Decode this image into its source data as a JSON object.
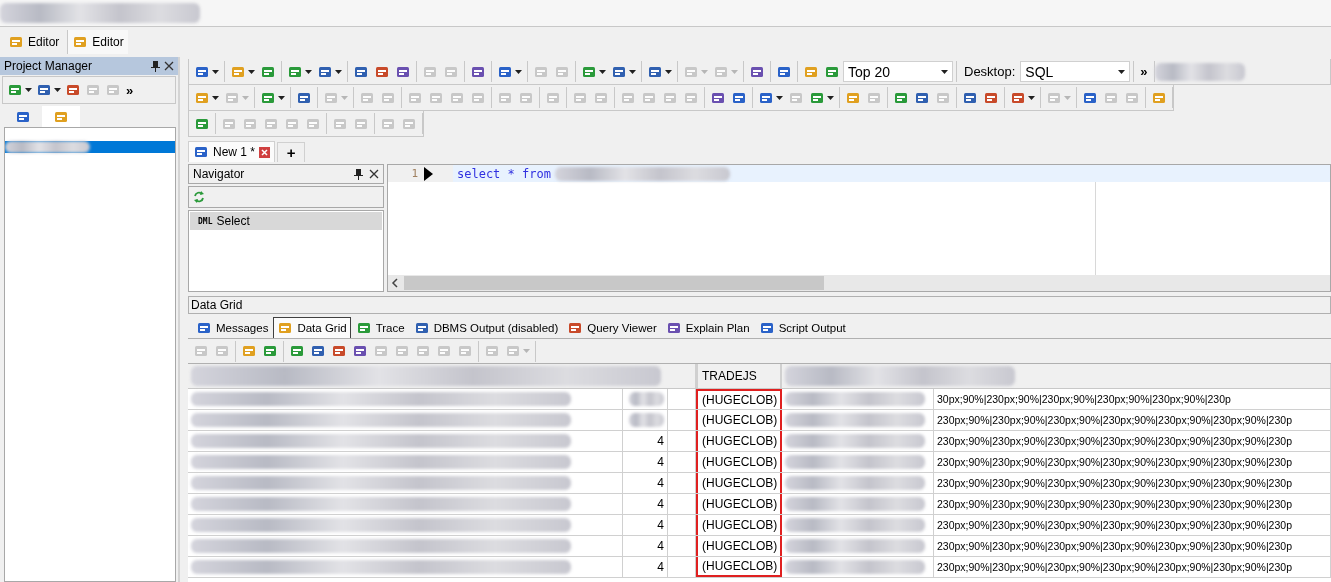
{
  "window_tabs": [
    {
      "label": "Editor",
      "selected": false
    },
    {
      "label": "Editor",
      "selected": true
    }
  ],
  "toolbars": [
    {
      "groups": [
        [
          {
            "kind": "menu_button",
            "disabled": false
          }
        ],
        [
          {
            "kind": "menu_button",
            "disabled": false
          },
          {
            "kind": "button",
            "disabled": false
          }
        ],
        [
          {
            "kind": "menu_button",
            "disabled": false
          },
          {
            "kind": "menu_button",
            "disabled": false
          }
        ],
        [
          {
            "kind": "button",
            "disabled": false
          },
          {
            "kind": "button",
            "disabled": false
          },
          {
            "kind": "button",
            "disabled": false
          }
        ],
        [
          {
            "kind": "button",
            "disabled": true
          },
          {
            "kind": "button",
            "disabled": true
          }
        ],
        [
          {
            "kind": "button",
            "disabled": false
          }
        ],
        [
          {
            "kind": "menu_button",
            "disabled": false
          }
        ],
        [
          {
            "kind": "button",
            "disabled": true
          },
          {
            "kind": "button",
            "disabled": true
          }
        ],
        [
          {
            "kind": "menu_button",
            "disabled": false
          },
          {
            "kind": "menu_button",
            "disabled": false
          }
        ],
        [
          {
            "kind": "menu_button",
            "disabled": false
          }
        ],
        [
          {
            "kind": "menu_button",
            "disabled": true
          },
          {
            "kind": "menu_button",
            "disabled": true
          }
        ],
        [
          {
            "kind": "button",
            "disabled": false
          }
        ],
        [
          {
            "kind": "button",
            "disabled": false
          }
        ],
        [
          {
            "kind": "button",
            "disabled": false
          },
          {
            "kind": "button",
            "disabled": false
          },
          {
            "kind": "combo",
            "value": "Top 20"
          }
        ],
        [
          {
            "kind": "label",
            "text": "Desktop:"
          },
          {
            "kind": "combo",
            "value": "SQL"
          }
        ],
        [
          {
            "kind": "more",
            "text": "»"
          }
        ]
      ]
    },
    {
      "groups": [
        [
          {
            "kind": "menu_button",
            "disabled": false
          },
          {
            "kind": "menu_button",
            "disabled": true
          }
        ],
        [
          {
            "kind": "menu_button",
            "disabled": false
          }
        ],
        [
          {
            "kind": "button",
            "disabled": false
          }
        ],
        [
          {
            "kind": "menu_button",
            "disabled": true
          }
        ],
        [
          {
            "kind": "button",
            "disabled": true
          },
          {
            "kind": "button",
            "disabled": true
          }
        ],
        [
          {
            "kind": "button",
            "disabled": true
          },
          {
            "kind": "button",
            "disabled": true
          },
          {
            "kind": "button",
            "disabled": true
          },
          {
            "kind": "button",
            "disabled": true
          }
        ],
        [
          {
            "kind": "button",
            "disabled": true
          },
          {
            "kind": "button",
            "disabled": true
          }
        ],
        [
          {
            "kind": "button",
            "disabled": true
          }
        ],
        [
          {
            "kind": "button",
            "disabled": true
          },
          {
            "kind": "button",
            "disabled": true
          }
        ],
        [
          {
            "kind": "button",
            "disabled": true
          },
          {
            "kind": "button",
            "disabled": true
          },
          {
            "kind": "button",
            "disabled": true
          },
          {
            "kind": "button",
            "disabled": true
          }
        ],
        [
          {
            "kind": "button",
            "disabled": false
          },
          {
            "kind": "button",
            "disabled": false
          }
        ],
        [
          {
            "kind": "menu_button",
            "disabled": false
          },
          {
            "kind": "button",
            "disabled": true
          },
          {
            "kind": "menu_button",
            "disabled": false
          }
        ],
        [
          {
            "kind": "button",
            "disabled": false
          },
          {
            "kind": "button",
            "disabled": true
          }
        ],
        [
          {
            "kind": "button",
            "disabled": false
          },
          {
            "kind": "button",
            "disabled": false
          },
          {
            "kind": "button",
            "disabled": true
          }
        ],
        [
          {
            "kind": "button",
            "disabled": false
          },
          {
            "kind": "button",
            "disabled": false
          }
        ],
        [
          {
            "kind": "menu_button",
            "disabled": false
          }
        ],
        [
          {
            "kind": "menu_button",
            "disabled": true
          }
        ],
        [
          {
            "kind": "button",
            "disabled": false
          },
          {
            "kind": "button",
            "disabled": true
          },
          {
            "kind": "button",
            "disabled": true
          }
        ],
        [
          {
            "kind": "button",
            "disabled": false
          }
        ]
      ]
    },
    {
      "groups": [
        [
          {
            "kind": "button",
            "disabled": false
          }
        ],
        [
          {
            "kind": "button",
            "disabled": true
          },
          {
            "kind": "button",
            "disabled": true
          },
          {
            "kind": "button",
            "disabled": true
          },
          {
            "kind": "button",
            "disabled": true
          },
          {
            "kind": "button",
            "disabled": true
          }
        ],
        [
          {
            "kind": "button",
            "disabled": true
          },
          {
            "kind": "button",
            "disabled": true
          }
        ],
        [
          {
            "kind": "button",
            "disabled": true
          },
          {
            "kind": "button",
            "disabled": true
          }
        ]
      ]
    }
  ],
  "project_manager": {
    "title": "Project Manager",
    "toolbar": [
      {
        "kind": "menu_button",
        "disabled": false
      },
      {
        "kind": "menu_button",
        "disabled": false
      },
      {
        "kind": "button",
        "disabled": false
      },
      {
        "kind": "button",
        "disabled": true
      },
      {
        "kind": "button",
        "disabled": true
      },
      {
        "kind": "more",
        "text": "»"
      }
    ],
    "tabs": [
      {
        "selected": false
      },
      {
        "selected": true
      }
    ],
    "tree_items": [
      {
        "selected": true
      }
    ]
  },
  "document_tabs": [
    {
      "label": "New 1 *",
      "selected": true
    }
  ],
  "new_tab_button": "+",
  "navigator": {
    "title": "Navigator",
    "items": [
      {
        "tag": "DML",
        "label": "Select",
        "selected": true
      }
    ]
  },
  "editor": {
    "lines": [
      {
        "number": "1",
        "code": "select * from",
        "current": true
      }
    ]
  },
  "data_grid": {
    "title": "Data Grid",
    "tabs": [
      {
        "label": "Messages",
        "selected": false
      },
      {
        "label": "Data Grid",
        "selected": true
      },
      {
        "label": "Trace",
        "selected": false
      },
      {
        "label": "DBMS Output (disabled)",
        "selected": false
      },
      {
        "label": "Query Viewer",
        "selected": false
      },
      {
        "label": "Explain Plan",
        "selected": false
      },
      {
        "label": "Script Output",
        "selected": false
      }
    ],
    "toolbar": [
      [
        {
          "kind": "button",
          "disabled": true
        },
        {
          "kind": "button",
          "disabled": true
        }
      ],
      [
        {
          "kind": "button",
          "disabled": false
        },
        {
          "kind": "button",
          "disabled": false
        }
      ],
      [
        {
          "kind": "button",
          "disabled": false
        },
        {
          "kind": "button",
          "disabled": false
        },
        {
          "kind": "button",
          "disabled": false
        },
        {
          "kind": "button",
          "disabled": false
        },
        {
          "kind": "button",
          "disabled": true
        },
        {
          "kind": "button",
          "disabled": true
        },
        {
          "kind": "button",
          "disabled": true
        },
        {
          "kind": "button",
          "disabled": true
        },
        {
          "kind": "button",
          "disabled": true
        }
      ],
      [
        {
          "kind": "button",
          "disabled": true
        },
        {
          "kind": "menu_button",
          "disabled": true
        }
      ]
    ],
    "tradejs_header": "TRADEJS",
    "tradejs_outlined": true,
    "rows": [
      {
        "tradejs": "(HUGECLOB)",
        "column_6": "30px;90%|230px;90%|230px;90%|230px;90%|230px;90%|230p"
      },
      {
        "tradejs": "(HUGECLOB)",
        "column_6": "230px;90%|230px;90%|230px;90%|230px;90%|230px;90%|230px;90%|230p"
      },
      {
        "column_2": "4",
        "tradejs": "(HUGECLOB)",
        "column_6": "230px;90%|230px;90%|230px;90%|230px;90%|230px;90%|230px;90%|230p"
      },
      {
        "column_2": "4",
        "tradejs": "(HUGECLOB)",
        "column_6": "230px;90%|230px;90%|230px;90%|230px;90%|230px;90%|230px;90%|230p"
      },
      {
        "column_2": "4",
        "tradejs": "(HUGECLOB)",
        "column_6": "230px;90%|230px;90%|230px;90%|230px;90%|230px;90%|230px;90%|230p"
      },
      {
        "column_2": "4",
        "tradejs": "(HUGECLOB)",
        "column_6": "230px;90%|230px;90%|230px;90%|230px;90%|230px;90%|230px;90%|230p"
      },
      {
        "column_2": "4",
        "tradejs": "(HUGECLOB)",
        "column_6": "230px;90%|230px;90%|230px;90%|230px;90%|230px;90%|230px;90%|230p"
      },
      {
        "column_2": "4",
        "tradejs": "(HUGECLOB)",
        "column_6": "230px;90%|230px;90%|230px;90%|230px;90%|230px;90%|230px;90%|230p"
      },
      {
        "column_2": "4",
        "tradejs": "(HUGECLOB)",
        "column_6": "230px;90%|230px;90%|230px;90%|230px;90%|230px;90%|230px;90%|230p"
      }
    ]
  }
}
